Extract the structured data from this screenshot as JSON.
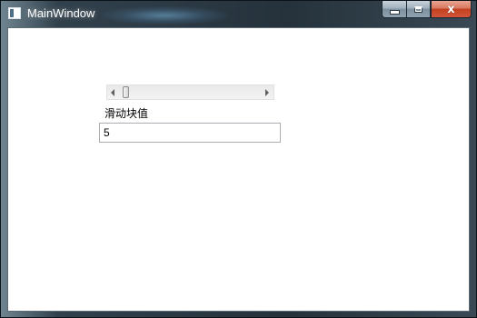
{
  "window": {
    "title": "MainWindow",
    "caption_buttons": {
      "minimize_icon": "minimize-icon",
      "maximize_icon": "maximize-icon",
      "close_icon": "close-icon",
      "close_glyph": "x"
    }
  },
  "slider": {
    "value": 5,
    "left_arrow_icon": "arrow-left-icon",
    "right_arrow_icon": "arrow-right-icon"
  },
  "label": {
    "text": "滑动块值"
  },
  "textbox": {
    "value": "5"
  }
}
